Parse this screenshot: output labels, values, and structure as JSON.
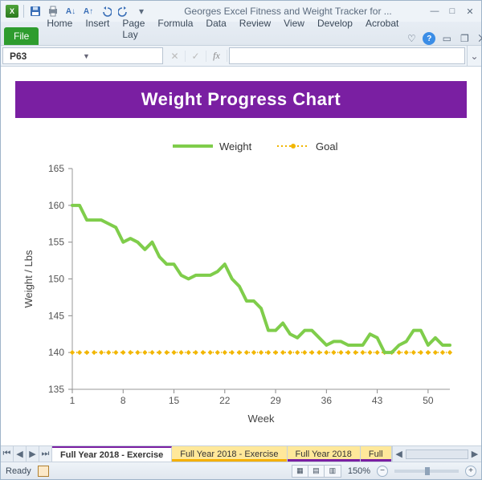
{
  "window_title": "Georges Excel Fitness and Weight Tracker for ...",
  "ribbon": {
    "file": "File",
    "tabs": [
      "Home",
      "Insert",
      "Page Lay",
      "Formula",
      "Data",
      "Review",
      "View",
      "Develop",
      "Acrobat"
    ]
  },
  "namebox": "P63",
  "formula": "",
  "fx_label": "fx",
  "chart_banner": "Weight Progress Chart",
  "sheet_tabs": [
    {
      "label": "Full Year 2018 - Exercise",
      "active": true,
      "color": "orange"
    },
    {
      "label": "Full Year 2018 - Exercise",
      "active": false,
      "color": "orange"
    },
    {
      "label": "Full Year 2018",
      "active": false,
      "color": "purple"
    },
    {
      "label": "Full",
      "active": false,
      "color": "purple"
    }
  ],
  "status": {
    "ready": "Ready",
    "zoom": "150%"
  },
  "chart_data": {
    "type": "line",
    "title": "Weight Progress Chart",
    "xlabel": "Week",
    "ylabel": "Weight / Lbs",
    "x_ticks": [
      1,
      8,
      15,
      22,
      29,
      36,
      43,
      50
    ],
    "y_ticks": [
      135,
      140,
      145,
      150,
      155,
      160,
      165
    ],
    "xlim": [
      1,
      53
    ],
    "ylim": [
      135,
      165
    ],
    "series": [
      {
        "name": "Weight",
        "color": "#7fcd4b",
        "x": [
          1,
          2,
          3,
          4,
          5,
          6,
          7,
          8,
          9,
          10,
          11,
          12,
          13,
          14,
          15,
          16,
          17,
          18,
          19,
          20,
          21,
          22,
          23,
          24,
          25,
          26,
          27,
          28,
          29,
          30,
          31,
          32,
          33,
          34,
          35,
          36,
          37,
          38,
          39,
          40,
          41,
          42,
          43,
          44,
          45,
          46,
          47,
          48,
          49,
          50,
          51,
          52,
          53
        ],
        "values": [
          160,
          160,
          158,
          158,
          158,
          157.5,
          157,
          155,
          155.5,
          155,
          154,
          155,
          153,
          152,
          152,
          150.5,
          150,
          150.5,
          150.5,
          150.5,
          151,
          152,
          150,
          149,
          147,
          147,
          146,
          143,
          143,
          144,
          142.5,
          142,
          143,
          143,
          142,
          141,
          141.5,
          141.5,
          141,
          141,
          141,
          142.5,
          142,
          140,
          140,
          141,
          141.5,
          143,
          143,
          141,
          142,
          141,
          141
        ]
      },
      {
        "name": "Goal",
        "color": "#f2b600",
        "x": [
          1,
          53
        ],
        "values": [
          140,
          140
        ],
        "style": "dotted-with-markers"
      }
    ],
    "legend_position": "top"
  }
}
